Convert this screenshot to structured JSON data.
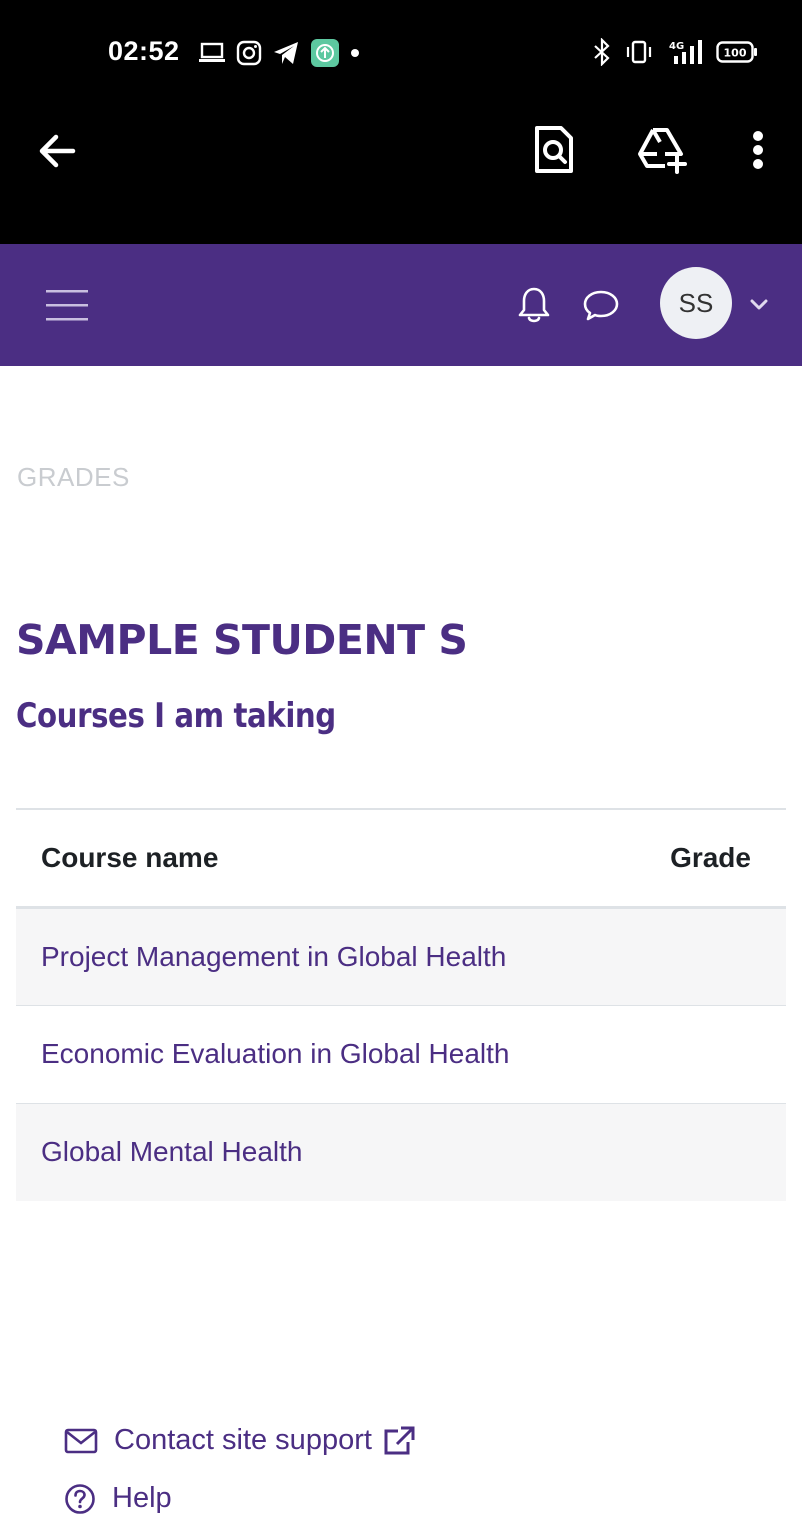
{
  "status_bar": {
    "time": "02:52",
    "battery": "100",
    "network": "4G"
  },
  "browser_bar": {
    "icons": [
      "back-arrow-icon",
      "page-search-icon",
      "drive-add-icon",
      "more-vert-icon"
    ]
  },
  "top_nav": {
    "avatar_initials": "SS",
    "icons": [
      "hamburger-menu-icon",
      "bell-icon",
      "chat-icon",
      "chevron-down-icon"
    ],
    "color": "#4b2e83"
  },
  "breadcrumb": "GRADES",
  "page": {
    "title": "SAMPLE STUDENT S",
    "subtitle": "Courses I am taking"
  },
  "table": {
    "columns": [
      "Course name",
      "Grade"
    ],
    "rows": [
      {
        "course": "Project Management in Global Health",
        "grade": ""
      },
      {
        "course": "Economic Evaluation in Global Health",
        "grade": ""
      },
      {
        "course": "Global Mental Health",
        "grade": ""
      }
    ]
  },
  "footer": {
    "contact_label": "Contact site support",
    "help_label": "Help"
  },
  "colors": {
    "brand_purple": "#4b2e83",
    "breadcrumb_gray": "#c9ccd0",
    "row_stripe": "#f6f6f7"
  }
}
